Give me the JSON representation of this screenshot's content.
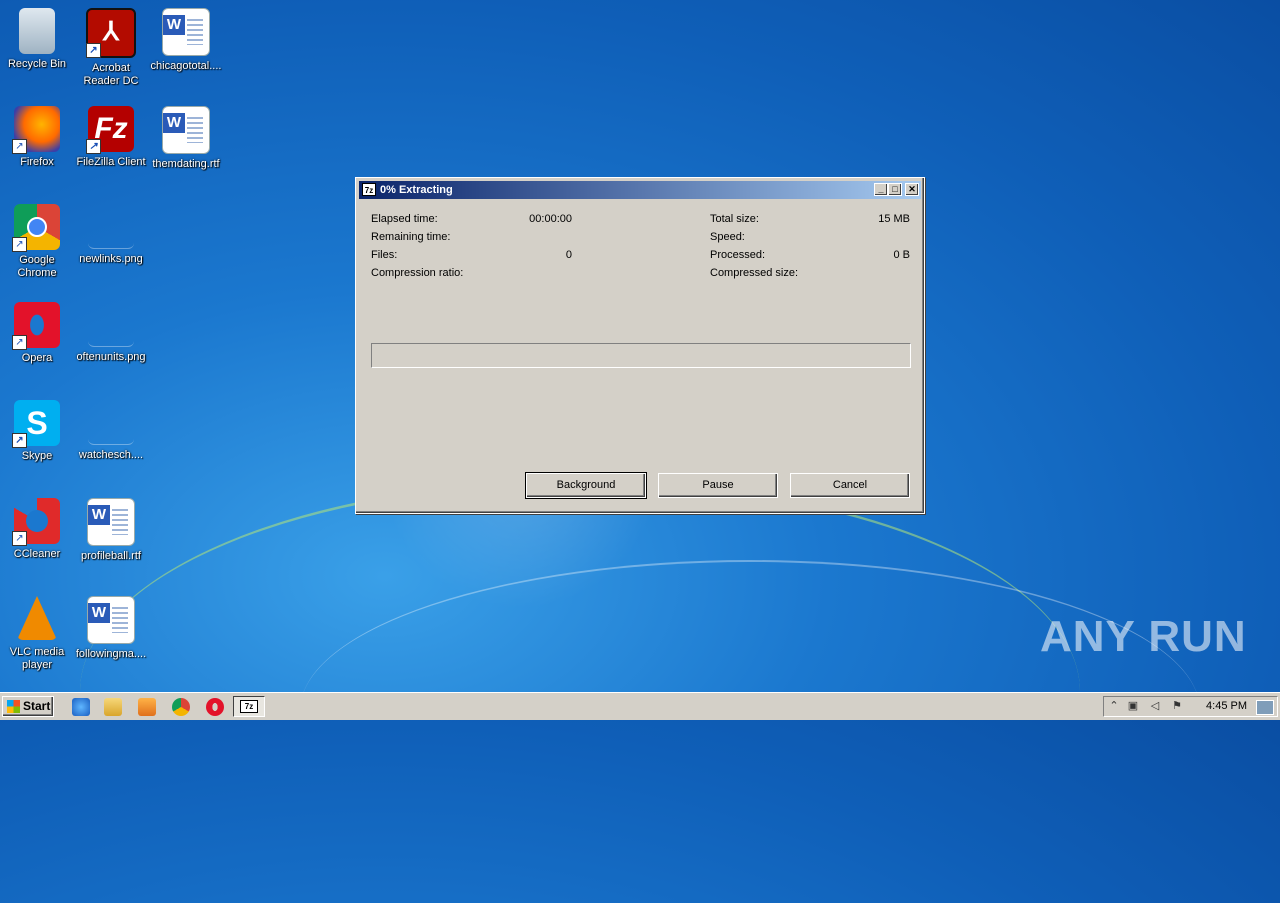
{
  "desktop": {
    "icons": [
      {
        "label": "Recycle Bin",
        "icon": "recycle-bin-icon"
      },
      {
        "label": "Acrobat Reader DC",
        "icon": "acrobat-icon"
      },
      {
        "label": "chicagototal....",
        "icon": "word-doc-icon"
      },
      {
        "label": "Firefox",
        "icon": "firefox-icon"
      },
      {
        "label": "FileZilla Client",
        "icon": "filezilla-icon"
      },
      {
        "label": "themdating.rtf",
        "icon": "word-doc-icon"
      },
      {
        "label": "Google Chrome",
        "icon": "chrome-icon"
      },
      {
        "label": "newlinks.png",
        "icon": "image-file-icon"
      },
      {
        "label": "Opera",
        "icon": "opera-icon"
      },
      {
        "label": "oftenunits.png",
        "icon": "image-file-icon"
      },
      {
        "label": "Skype",
        "icon": "skype-icon"
      },
      {
        "label": "watchesch....",
        "icon": "image-file-icon"
      },
      {
        "label": "CCleaner",
        "icon": "ccleaner-icon"
      },
      {
        "label": "profileball.rtf",
        "icon": "word-doc-icon"
      },
      {
        "label": "VLC media player",
        "icon": "vlc-icon"
      },
      {
        "label": "followingma....",
        "icon": "word-doc-icon"
      }
    ],
    "watermark": "ANY RUN"
  },
  "dialog": {
    "title": "0% Extracting",
    "app_icon_text": "7z",
    "left_stats": [
      {
        "label": "Elapsed time:",
        "value": "00:00:00"
      },
      {
        "label": "Remaining time:",
        "value": ""
      },
      {
        "label": "Files:",
        "value": "0"
      },
      {
        "label": "Compression ratio:",
        "value": ""
      }
    ],
    "right_stats": [
      {
        "label": "Total size:",
        "value": "15 MB"
      },
      {
        "label": "Speed:",
        "value": ""
      },
      {
        "label": "Processed:",
        "value": "0 B"
      },
      {
        "label": "Compressed size:",
        "value": ""
      }
    ],
    "progress_percent": 0,
    "buttons": {
      "background": "Background",
      "pause": "Pause",
      "cancel": "Cancel"
    },
    "window_controls": {
      "minimize": "_",
      "maximize": "□",
      "close": "✕"
    }
  },
  "taskbar": {
    "start_label": "Start",
    "quick_launch": [
      "ie-icon",
      "explorer-icon",
      "media-player-icon",
      "chrome-icon",
      "opera-icon"
    ],
    "active_task_icon_text": "7z",
    "tray": {
      "clock": "4:45 PM",
      "expand": "⌃"
    }
  }
}
